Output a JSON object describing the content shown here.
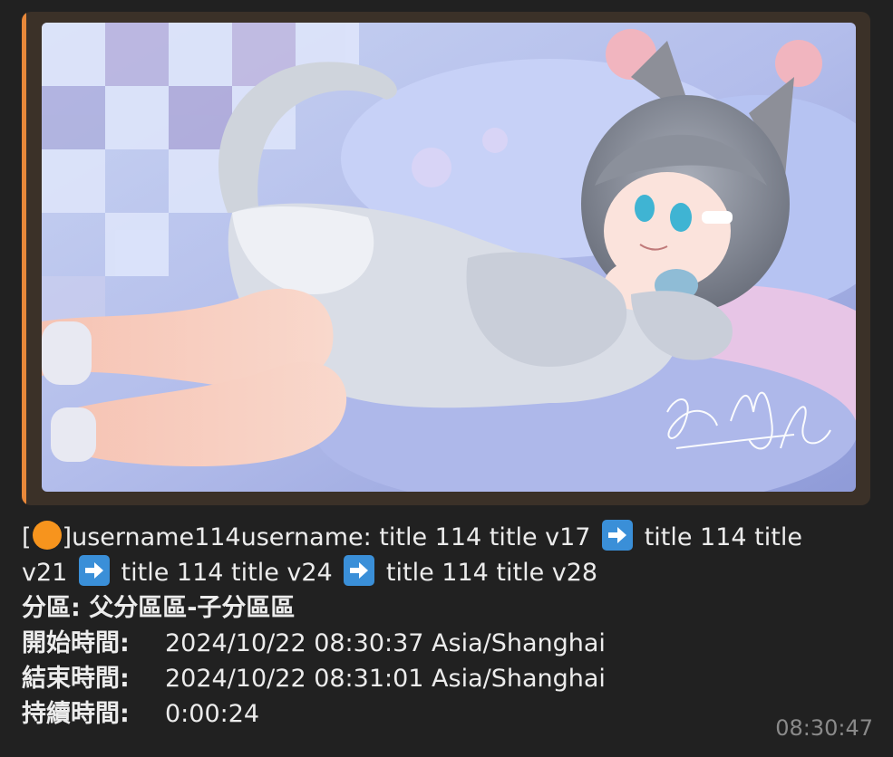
{
  "preview": {
    "image_alt": "anime illustration of a cat-eared girl lying on pillows",
    "signature": "Amano Mai"
  },
  "message": {
    "bracket_open": "[",
    "bracket_close": "]",
    "username": "username114username:",
    "title1": "title 114 title v17",
    "title2": "title 114 title",
    "title2b": "v21",
    "title3": "title 114 title v24",
    "title4": "title 114 title v28",
    "category_label": "分區:",
    "category_value": "父分區區-子分區區",
    "start_label": "開始時間:",
    "start_value": "2024/10/22 08:30:37 Asia/Shanghai",
    "end_label": "結束時間:",
    "end_value": "2024/10/22 08:31:01 Asia/Shanghai",
    "duration_label": "持續時間:",
    "duration_value": "0:00:24"
  },
  "timestamp": "08:30:47",
  "colors": {
    "accent_bar": "#e8883a",
    "arrow_emoji_bg": "#3a8fd8",
    "status_dot": "#f7941d"
  }
}
